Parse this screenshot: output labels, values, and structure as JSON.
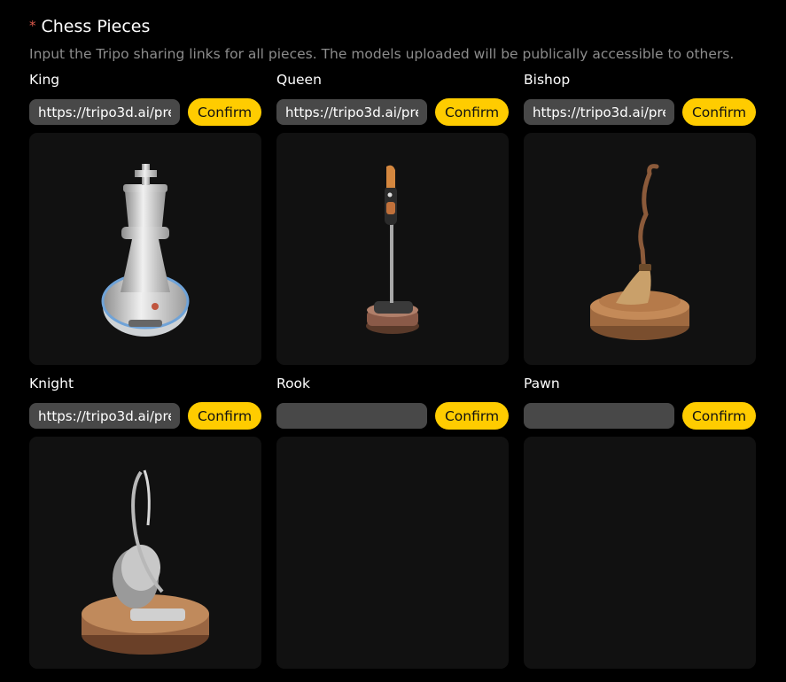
{
  "section": {
    "required_mark": "*",
    "title": "Chess Pieces",
    "description": "Input the Tripo sharing links for all pieces. The models uploaded will be publically accessible to others."
  },
  "pieces": [
    {
      "label": "King",
      "url": "https://tripo3d.ai/pre",
      "confirm": "Confirm",
      "model": "chess-king"
    },
    {
      "label": "Queen",
      "url": "https://tripo3d.ai/pre",
      "confirm": "Confirm",
      "model": "stick-vacuum"
    },
    {
      "label": "Bishop",
      "url": "https://tripo3d.ai/pre",
      "confirm": "Confirm",
      "model": "broom"
    },
    {
      "label": "Knight",
      "url": "https://tripo3d.ai/pre",
      "confirm": "Confirm",
      "model": "canister-vacuum"
    },
    {
      "label": "Rook",
      "url": "",
      "confirm": "Confirm",
      "model": ""
    },
    {
      "label": "Pawn",
      "url": "",
      "confirm": "Confirm",
      "model": ""
    }
  ],
  "colors": {
    "background": "#000000",
    "card": "#111111",
    "input": "#484848",
    "accent": "#ffcc00",
    "required": "#e05a4d",
    "muted_text": "#8c8c8c"
  }
}
